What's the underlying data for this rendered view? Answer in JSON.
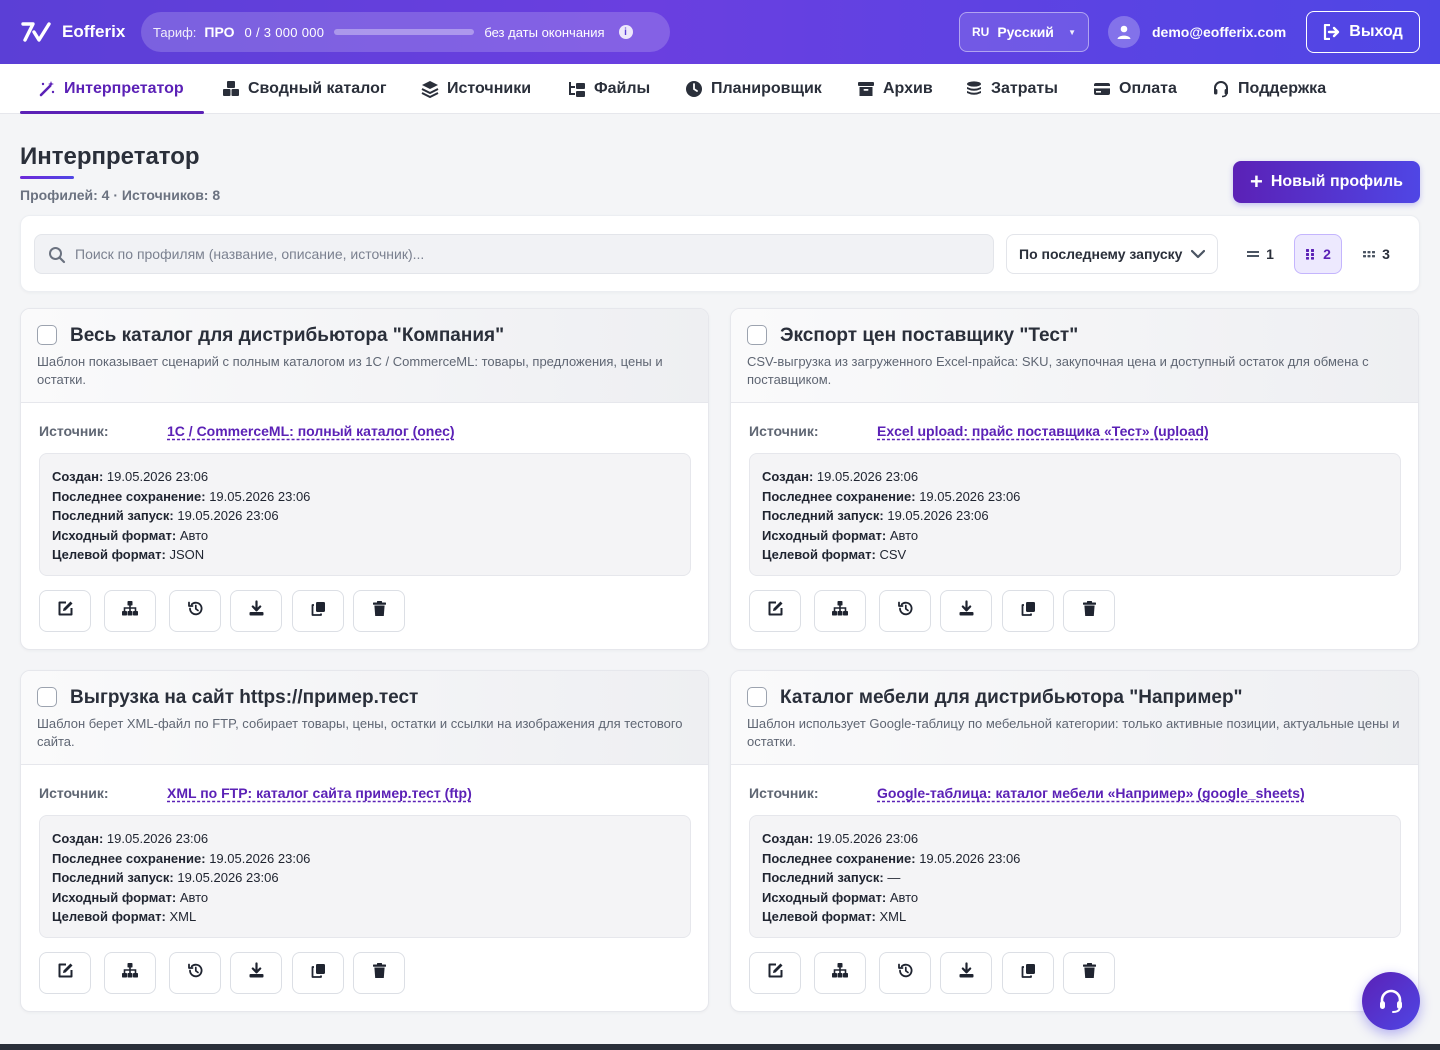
{
  "app": {
    "name": "Eofferix"
  },
  "tariff": {
    "label": "Тариф:",
    "plan": "ПРО",
    "quota": "0  /  3 000 000",
    "progress": 0,
    "no_end": "без даты окончания"
  },
  "lang": {
    "code": "RU",
    "name": "Русский"
  },
  "user": {
    "email": "demo@eofferix.com"
  },
  "logout_label": "Выход",
  "nav": [
    {
      "label": "Интерпретатор",
      "icon": "magic-wand-icon",
      "active": true
    },
    {
      "label": "Сводный каталог",
      "icon": "boxes-icon"
    },
    {
      "label": "Источники",
      "icon": "layers-icon"
    },
    {
      "label": "Файлы",
      "icon": "folder-tree-icon"
    },
    {
      "label": "Планировщик",
      "icon": "clock-icon"
    },
    {
      "label": "Архив",
      "icon": "archive-icon"
    },
    {
      "label": "Затраты",
      "icon": "coins-icon"
    },
    {
      "label": "Оплата",
      "icon": "credit-card-icon"
    },
    {
      "label": "Поддержка",
      "icon": "headset-icon"
    }
  ],
  "page": {
    "title": "Интерпретатор",
    "subtitle": "Профилей: 4 · Источников: 8",
    "new_profile": "Новый профиль"
  },
  "toolbar": {
    "search_placeholder": "Поиск по профилям (название, описание, источник)...",
    "sort_label": "По последнему запуску",
    "columns": [
      "1",
      "2",
      "3"
    ],
    "columns_active": "2"
  },
  "labels": {
    "source": "Источник:",
    "created": "Создан:",
    "last_saved": "Последнее сохранение:",
    "last_run": "Последний запуск:",
    "source_format": "Исходный формат:",
    "target_format": "Целевой формат:"
  },
  "profiles": [
    {
      "title": "Весь каталог для дистрибьютора \"Компания\"",
      "description": "Шаблон показывает сценарий с полным каталогом из 1С / CommerceML: товары, предложения, цены и остатки.",
      "source": "1С / CommerceML: полный каталог (onec)",
      "created": "19.05.2026 23:06",
      "last_saved": "19.05.2026 23:06",
      "last_run": "19.05.2026 23:06",
      "source_format": "Авто",
      "target_format": "JSON"
    },
    {
      "title": "Экспорт цен поставщику \"Тест\"",
      "description": "CSV-выгрузка из загруженного Excel-прайса: SKU, закупочная цена и доступный остаток для обмена с поставщиком.",
      "source": "Excel upload: прайс поставщика «Тест» (upload)",
      "created": "19.05.2026 23:06",
      "last_saved": "19.05.2026 23:06",
      "last_run": "19.05.2026 23:06",
      "source_format": "Авто",
      "target_format": "CSV"
    },
    {
      "title": "Выгрузка на сайт https://пример.тест",
      "description": "Шаблон берет XML-файл по FTP, собирает товары, цены, остатки и ссылки на изображения для тестового сайта.",
      "source": "XML по FTP: каталог сайта пример.тест (ftp)",
      "created": "19.05.2026 23:06",
      "last_saved": "19.05.2026 23:06",
      "last_run": "19.05.2026 23:06",
      "source_format": "Авто",
      "target_format": "XML"
    },
    {
      "title": "Каталог мебели для дистрибьютора \"Например\"",
      "description": "Шаблон использует Google-таблицу по мебельной категории: только активные позиции, актуальные цены и остатки.",
      "source": "Google-таблица: каталог мебели «Например» (google_sheets)",
      "created": "19.05.2026 23:06",
      "last_saved": "19.05.2026 23:06",
      "last_run": "—",
      "source_format": "Авто",
      "target_format": "XML"
    }
  ],
  "card_actions": [
    "edit-icon",
    "sitemap-icon",
    "history-icon",
    "download-icon",
    "copy-icon",
    "trash-icon"
  ]
}
